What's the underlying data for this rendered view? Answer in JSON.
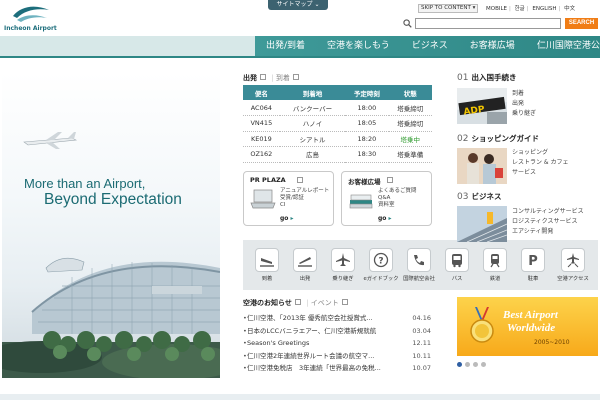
{
  "header": {
    "logo_text": "Incheon Airport",
    "sitemap_label": "サイトマップ ⌄",
    "skip_label": "SKIP TO CONTENT ▾",
    "util_links": [
      "MOBILE",
      "한글",
      "ENGLISH",
      "中文"
    ],
    "search_placeholder": "",
    "search_button": "SEARCH"
  },
  "nav": {
    "items": [
      "出発/到着",
      "空港を楽しもう",
      "ビジネス",
      "お客様広場",
      "仁川国際空港公社"
    ]
  },
  "hero": {
    "line1": "More than an Airport,",
    "line2": "Beyond Expectation"
  },
  "flights": {
    "tab_departure": "出発",
    "tab_arrival": "到着",
    "headers": [
      "便名",
      "到着地",
      "予定時刻",
      "状態"
    ],
    "rows": [
      [
        "AC064",
        "バンクーバー",
        "18:00",
        "塔乗締切"
      ],
      [
        "VN415",
        "ハノイ",
        "18:05",
        "塔乗締切"
      ],
      [
        "KE019",
        "シアトル",
        "18:20",
        "塔乗中"
      ],
      [
        "OZ162",
        "広島",
        "18:30",
        "塔乗準備"
      ]
    ]
  },
  "promo": {
    "pr_title": "PR PLAZA",
    "pr_text": "アニュアルレポート\n受賞/認証\nCI",
    "cs_title": "お客様広場",
    "cs_text": "よくあるご質問\nQ&A\n資料室",
    "go_label": "go"
  },
  "services": {
    "items": [
      "到着",
      "出発",
      "乗り継ぎ",
      "eガイドブック",
      "国際航空会社",
      "バス",
      "鉄道",
      "駐車",
      "空港アクセス"
    ]
  },
  "news": {
    "tab_notice": "空港のお知らせ",
    "tab_event": "イベント",
    "items": [
      {
        "text": "仁川空港、「2013年 優秀航空会社授賞式...",
        "date": "04.16"
      },
      {
        "text": "日本のLCCバニラエアー、仁川空港新規就航",
        "date": "03.04"
      },
      {
        "text": "Season's Greetings",
        "date": "12.11"
      },
      {
        "text": "仁川空港2年連続世界ルート会議の航空マ...",
        "date": "10.11"
      },
      {
        "text": "仁川空港免税店　3年連続「世界最高の免税...",
        "date": "10.07"
      }
    ]
  },
  "right": {
    "sections": [
      {
        "num": "01",
        "title": "出入国手続き",
        "links": [
          "到着",
          "出発",
          "乗り継ぎ"
        ]
      },
      {
        "num": "02",
        "title": "ショッピングガイド",
        "links": [
          "ショッピング",
          "レストラン & カフェ",
          "サービス"
        ]
      },
      {
        "num": "03",
        "title": "ビジネス",
        "links": [
          "コンサルティングサービス",
          "ロジスティクスサービス",
          "エアシティ開発"
        ]
      }
    ],
    "banner_line1": "Best Airport",
    "banner_line2": "Worldwide",
    "banner_years": "2005~2010"
  },
  "colors": {
    "teal": "#2e8785",
    "search_orange": "#f07d16",
    "hero_text": "#1b6b73"
  }
}
